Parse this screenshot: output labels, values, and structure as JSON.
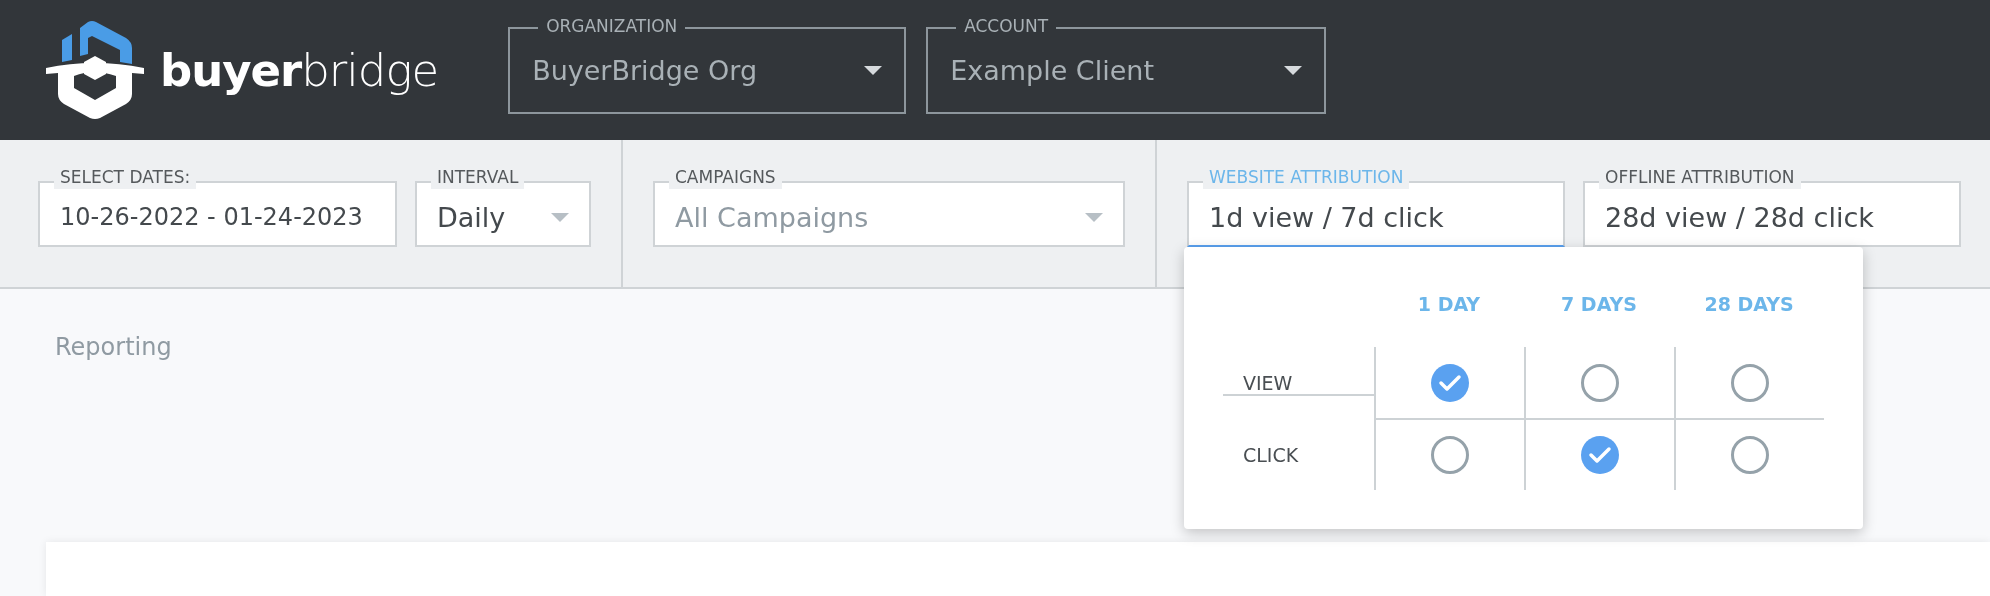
{
  "header": {
    "logo": "**buyer**bridge",
    "selectors": [
      {
        "label": "ORGANIZATION",
        "value": "BuyerBridge Org"
      },
      {
        "label": "ACCOUNT",
        "value": "Example Client"
      }
    ]
  },
  "filters": {
    "groups": [
      [
        {
          "kind": "text",
          "label": "SELECT DATES:",
          "value": "10-26-2022 - 01-24-2023",
          "focused": false
        },
        {
          "kind": "dropdown",
          "label": "INTERVAL",
          "value": "Daily"
        }
      ],
      [
        {
          "kind": "dropdown",
          "label": "CAMPAIGNS",
          "placeholder": "All Campaigns"
        }
      ],
      [
        {
          "kind": "text",
          "label": "WEBSITE ATTRIBUTION",
          "value": "1d view / 7d click",
          "focused": true
        },
        {
          "kind": "text",
          "label": "OFFLINE ATTRIBUTION",
          "value": "28d view / 28d click",
          "focused": false
        }
      ]
    ]
  },
  "attribution_menu": {
    "columns": [
      "1 DAY",
      "7 DAYS",
      "28 DAYS"
    ],
    "rows": [
      {
        "label": "VIEW",
        "options": [
          {
            "selected": true
          },
          {
            "selected": false
          },
          {
            "selected": false
          }
        ]
      },
      {
        "label": "CLICK",
        "options": [
          {
            "selected": false
          },
          {
            "selected": true
          },
          {
            "selected": false
          }
        ]
      }
    ]
  },
  "page": {
    "title": "Reporting"
  }
}
